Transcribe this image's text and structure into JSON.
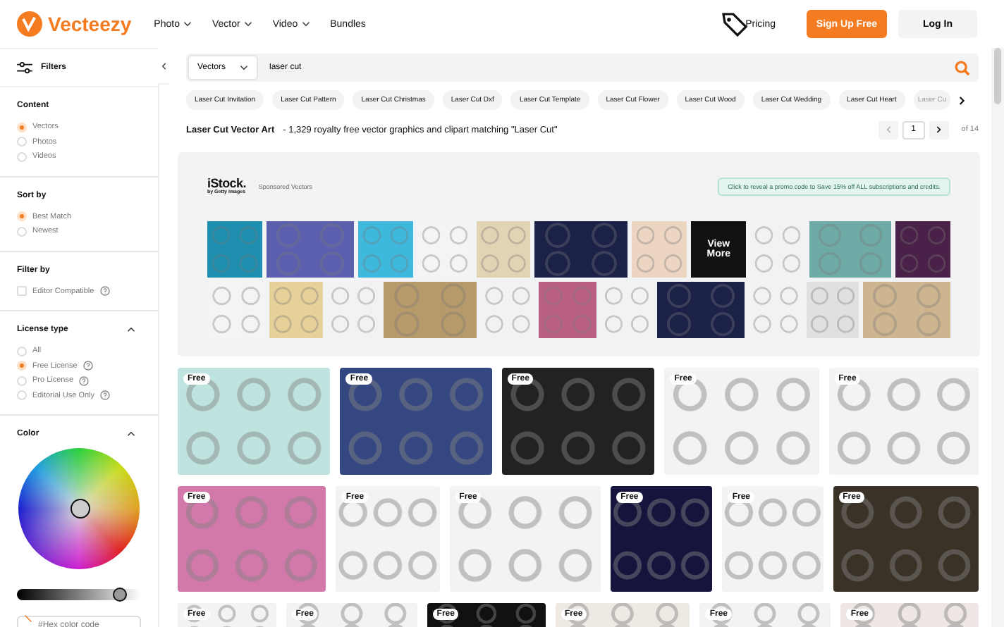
{
  "header": {
    "logo": "Vecteezy",
    "nav": [
      {
        "label": "Photo",
        "dropdown": true
      },
      {
        "label": "Vector",
        "dropdown": true
      },
      {
        "label": "Video",
        "dropdown": true
      },
      {
        "label": "Bundles",
        "dropdown": false
      }
    ],
    "pricing": "Pricing",
    "signup": "Sign Up Free",
    "login": "Log In"
  },
  "sidebar": {
    "title": "Filters",
    "sections": [
      {
        "title": "Content",
        "collapsible": false,
        "options": [
          {
            "kind": "radio",
            "label": "Vectors",
            "selected": true,
            "help": false
          },
          {
            "kind": "radio",
            "label": "Photos",
            "selected": false,
            "help": false
          },
          {
            "kind": "radio",
            "label": "Videos",
            "selected": false,
            "help": false
          }
        ]
      },
      {
        "title": "Sort by",
        "collapsible": false,
        "options": [
          {
            "kind": "radio",
            "label": "Best Match",
            "selected": true,
            "help": false
          },
          {
            "kind": "radio",
            "label": "Newest",
            "selected": false,
            "help": false
          }
        ]
      },
      {
        "title": "Filter by",
        "collapsible": false,
        "options": [
          {
            "kind": "checkbox",
            "label": "Editor Compatible",
            "selected": false,
            "help": true
          }
        ]
      },
      {
        "title": "License type",
        "collapsible": true,
        "options": [
          {
            "kind": "radio",
            "label": "All",
            "selected": false,
            "help": false
          },
          {
            "kind": "radio",
            "label": "Free License",
            "selected": true,
            "help": true
          },
          {
            "kind": "radio",
            "label": "Pro License",
            "selected": false,
            "help": true
          },
          {
            "kind": "radio",
            "label": "Editorial Use Only",
            "selected": false,
            "help": true
          }
        ]
      }
    ],
    "color": {
      "title": "Color",
      "level": 0.83,
      "placeholder": "#Hex color code"
    }
  },
  "search": {
    "type": "Vectors",
    "value": "laser cut"
  },
  "tags": [
    "Laser Cut Invitation",
    "Laser Cut Pattern",
    "Laser Cut Christmas",
    "Laser Cut Dxf",
    "Laser Cut Template",
    "Laser Cut Flower",
    "Laser Cut Wood",
    "Laser Cut Wedding",
    "Laser Cut Heart",
    "Laser Cu"
  ],
  "results": {
    "title": "Laser Cut Vector Art",
    "summary": "- 1,329 royalty free vector graphics and clipart matching \"Laser Cut\"",
    "page": "1",
    "of": "of 14"
  },
  "sponsored": {
    "brand": "iStock.",
    "brand_sub": "by Getty Images",
    "label": "Sponsored Vectors",
    "promo": "Click to reveal a promo code to Save 15% off ALL subscriptions and credits.",
    "rows": [
      [
        {
          "color": "#1f8fb0"
        },
        {
          "color": "#5b5fae"
        },
        {
          "color": "#3fb8de"
        },
        {
          "color": "#f4f4f4"
        },
        {
          "color": "#e2d3b4"
        },
        {
          "color": "#1c2148"
        },
        {
          "color": "#ecd6c2"
        },
        {
          "color": "#111111",
          "text": "View More"
        },
        {
          "color": "#f2f2f2"
        },
        {
          "color": "#6eaaa6"
        },
        {
          "color": "#4a2148"
        }
      ],
      [
        {
          "color": "#f4f4f4"
        },
        {
          "color": "#e6d199"
        },
        {
          "color": "#f2f2f2"
        },
        {
          "color": "#b79a6a"
        },
        {
          "color": "#f2f2f2"
        },
        {
          "color": "#b85f82"
        },
        {
          "color": "#f2f2f2"
        },
        {
          "color": "#1c2148"
        },
        {
          "color": "#f2f2f2"
        },
        {
          "color": "#e0e0e0"
        },
        {
          "color": "#cdb68f"
        }
      ]
    ]
  },
  "grid": [
    [
      {
        "color": "#bfe3df",
        "badge": "Free"
      },
      {
        "color": "#354780",
        "badge": "Free"
      },
      {
        "color": "#222222",
        "badge": "Free"
      },
      {
        "color": "#f2f3f4",
        "badge": "Free"
      },
      {
        "color": "#f2f3f4",
        "badge": "Free"
      }
    ],
    [
      {
        "color": "#d378aa",
        "badge": "Free"
      },
      {
        "color": "#f2f3f4",
        "badge": "Free"
      },
      {
        "color": "#f2f3f4",
        "badge": "Free"
      },
      {
        "color": "#14143d",
        "badge": "Free"
      },
      {
        "color": "#f2f3f4",
        "badge": "Free"
      },
      {
        "color": "#3a3226",
        "badge": "Free"
      }
    ],
    [
      {
        "color": "#f2f3f4",
        "badge": "Free"
      },
      {
        "color": "#f2f3f4",
        "badge": "Free"
      },
      {
        "color": "#111111",
        "badge": "Free"
      },
      {
        "color": "#efe9e4",
        "badge": "Free"
      },
      {
        "color": "#f2f3f4",
        "badge": "Free"
      },
      {
        "color": "#efe6e6",
        "badge": "Free"
      }
    ]
  ]
}
